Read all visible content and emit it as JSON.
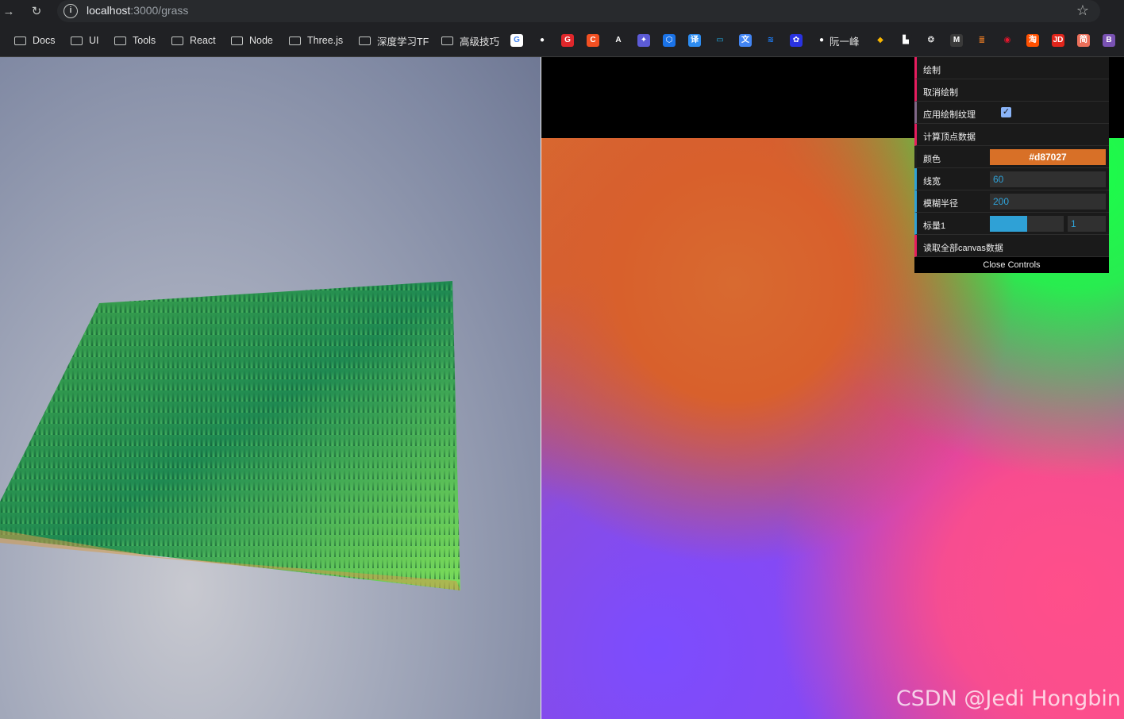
{
  "browser": {
    "url_host": "localhost",
    "url_path": ":3000/grass",
    "bookmarks": [
      {
        "label": "Docs",
        "type": "folder"
      },
      {
        "label": "UI",
        "type": "folder"
      },
      {
        "label": "Tools",
        "type": "folder"
      },
      {
        "label": "React",
        "type": "folder"
      },
      {
        "label": "Node",
        "type": "folder"
      },
      {
        "label": "Three.js",
        "type": "folder"
      },
      {
        "label": "深度学习TF",
        "type": "folder"
      },
      {
        "label": "高级技巧",
        "type": "folder"
      }
    ],
    "bookmark_icons": [
      {
        "name": "google-icon",
        "glyph": "G",
        "color": "#ffffff",
        "fg": "#4285f4"
      },
      {
        "name": "github-icon",
        "glyph": "●",
        "color": "#202124",
        "fg": "#ffffff"
      },
      {
        "name": "g-red-icon",
        "glyph": "G",
        "color": "#e0272b",
        "fg": "#ffffff"
      },
      {
        "name": "c-orange-icon",
        "glyph": "C",
        "color": "#f25022",
        "fg": "#ffffff"
      },
      {
        "name": "arrow-a-icon",
        "glyph": "A",
        "color": "#202124",
        "fg": "#ffffff"
      },
      {
        "name": "settings-purple-icon",
        "glyph": "✦",
        "color": "#5c5bd6",
        "fg": "#ffffff"
      },
      {
        "name": "hex-blue-icon",
        "glyph": "⬡",
        "color": "#1a73e8",
        "fg": "#ffffff"
      },
      {
        "name": "translate-icon",
        "glyph": "译",
        "color": "#2d8cf0",
        "fg": "#ffffff"
      },
      {
        "name": "bilibili-icon",
        "glyph": "▭",
        "color": "#202124",
        "fg": "#23ade5"
      },
      {
        "name": "google-translate-icon",
        "glyph": "文",
        "color": "#4285f4",
        "fg": "#ffffff"
      },
      {
        "name": "layers-icon",
        "glyph": "≋",
        "color": "#202124",
        "fg": "#1e80ff"
      },
      {
        "name": "baidu-icon",
        "glyph": "✿",
        "color": "#2932e1",
        "fg": "#ffffff"
      }
    ],
    "github_bookmark_label": "阮一峰",
    "bookmark_icons_right": [
      {
        "name": "sketch-icon",
        "glyph": "◆",
        "color": "#202124",
        "fg": "#f7b500"
      },
      {
        "name": "blocks-icon",
        "glyph": "▙",
        "color": "#202124",
        "fg": "#ffffff"
      },
      {
        "name": "openai-icon",
        "glyph": "❂",
        "color": "#202124",
        "fg": "#ffffff"
      },
      {
        "name": "m-icon",
        "glyph": "M",
        "color": "#3a3a3a",
        "fg": "#ffffff"
      },
      {
        "name": "stack-icon",
        "glyph": "≣",
        "color": "#202124",
        "fg": "#f48024"
      },
      {
        "name": "weibo-icon",
        "glyph": "◉",
        "color": "#202124",
        "fg": "#e6162d"
      },
      {
        "name": "taobao-icon",
        "glyph": "淘",
        "color": "#ff5000",
        "fg": "#ffffff"
      },
      {
        "name": "jd-icon",
        "glyph": "JD",
        "color": "#e1251b",
        "fg": "#ffffff"
      },
      {
        "name": "jian-icon",
        "glyph": "简",
        "color": "#ea6f5a",
        "fg": "#ffffff"
      },
      {
        "name": "b-purple-icon",
        "glyph": "B",
        "color": "#7952b3",
        "fg": "#ffffff"
      }
    ]
  },
  "gui": {
    "draw_label": "绘制",
    "undo_label": "取消绘制",
    "apply_texture_label": "应用绘制纹理",
    "apply_texture_checked": true,
    "compute_vertices_label": "计算顶点数据",
    "color_label": "颜色",
    "color_value": "#d87027",
    "line_width_label": "线宽",
    "line_width_value": "60",
    "blur_radius_label": "模糊半径",
    "blur_radius_value": "200",
    "scale_label": "标量1",
    "scale_value": "1",
    "scale_fraction": 0.5,
    "read_canvas_label": "读取全部canvas数据",
    "close_label": "Close Controls"
  },
  "watermark": "CSDN @Jedi Hongbin"
}
